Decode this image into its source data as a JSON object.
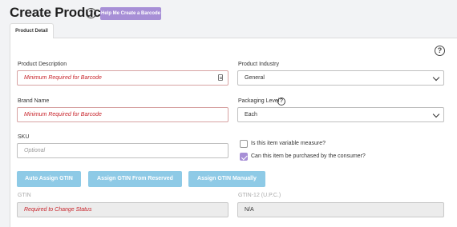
{
  "header": {
    "title": "Create Product",
    "help_glyph": "?",
    "barcode_button": "Help Me Create a Barcode"
  },
  "tabs": [
    {
      "label": "Product Detail",
      "active": true
    }
  ],
  "panel": {
    "help_glyph": "?"
  },
  "form": {
    "product_description": {
      "label": "Product Description",
      "placeholder": "Minimum Required for Barcode"
    },
    "brand_name": {
      "label": "Brand Name",
      "placeholder": "Minimum Required for Barcode"
    },
    "sku": {
      "label": "SKU",
      "placeholder": "Optional"
    },
    "product_industry": {
      "label": "Product Industry",
      "value": "General"
    },
    "packaging_level": {
      "label": "Packaging Level",
      "value": "Each",
      "help_glyph": "?"
    },
    "variable_measure": {
      "label": "Is this item variable measure?",
      "checked": false
    },
    "consumer_purchase": {
      "label": "Can this item be purchased by the consumer?",
      "checked": true
    },
    "gtin": {
      "label": "GTIN",
      "placeholder": "Required to Change Status"
    },
    "gtin12": {
      "label": "GTIN-12 (U.P.C.)",
      "value": "N/A"
    }
  },
  "actions": {
    "auto_assign": "Auto Assign GTIN",
    "from_reserved": "Assign GTIN From Reserved",
    "manually": "Assign GTIN Manually"
  },
  "colors": {
    "accent_purple": "#a78fd6",
    "button_blue": "#8ecae6",
    "required_red": "#c8252c"
  }
}
